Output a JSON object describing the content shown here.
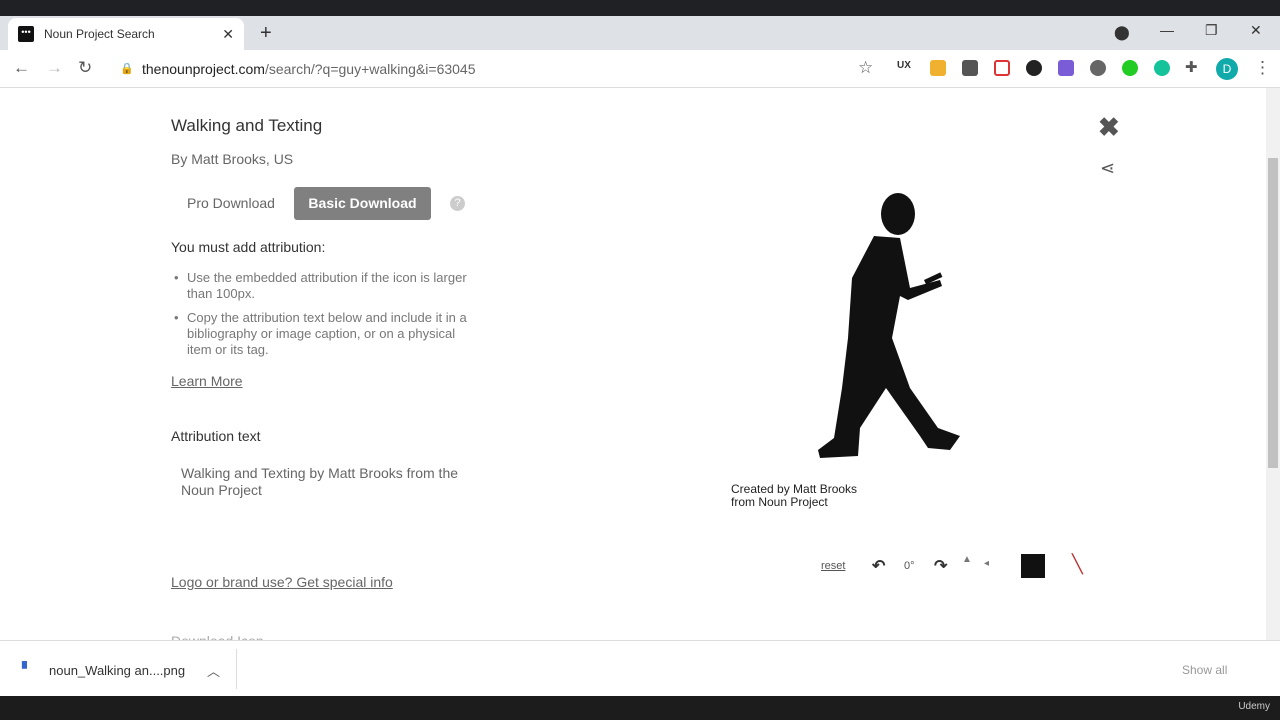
{
  "browser": {
    "tab_title": "Noun Project Search",
    "tab_close": "✕",
    "new_tab": "+",
    "url_host": "thenounproject.com",
    "url_path": "/search/?q=guy+walking&i=63045",
    "profile_initial": "D"
  },
  "icon": {
    "title": "Walking and Texting",
    "author": "By Matt Brooks, US",
    "pro_download": "Pro Download",
    "basic_download": "Basic Download",
    "help": "?",
    "must_attr": "You must add attribution:",
    "bullets": [
      "Use the embedded attribution if the icon is larger than 100px.",
      "Copy the attribution text below and include it in a bibliography or image caption, or on a physical item or its tag."
    ],
    "learn_more": "Learn More",
    "attr_label": "Attribution text",
    "attr_text": "Walking and Texting by Matt Brooks from the Noun Project",
    "logo_link": "Logo or brand use? Get special info",
    "download_icon": "Download Icon",
    "credit_line1": "Created by Matt Brooks",
    "credit_line2": "from Noun Project"
  },
  "controls": {
    "reset": "reset",
    "rotation": "0°",
    "color": "#111111"
  },
  "download_bar": {
    "file": "noun_Walking an....png",
    "show_all": "Show all"
  },
  "footer": {
    "brand": "Udemy"
  }
}
